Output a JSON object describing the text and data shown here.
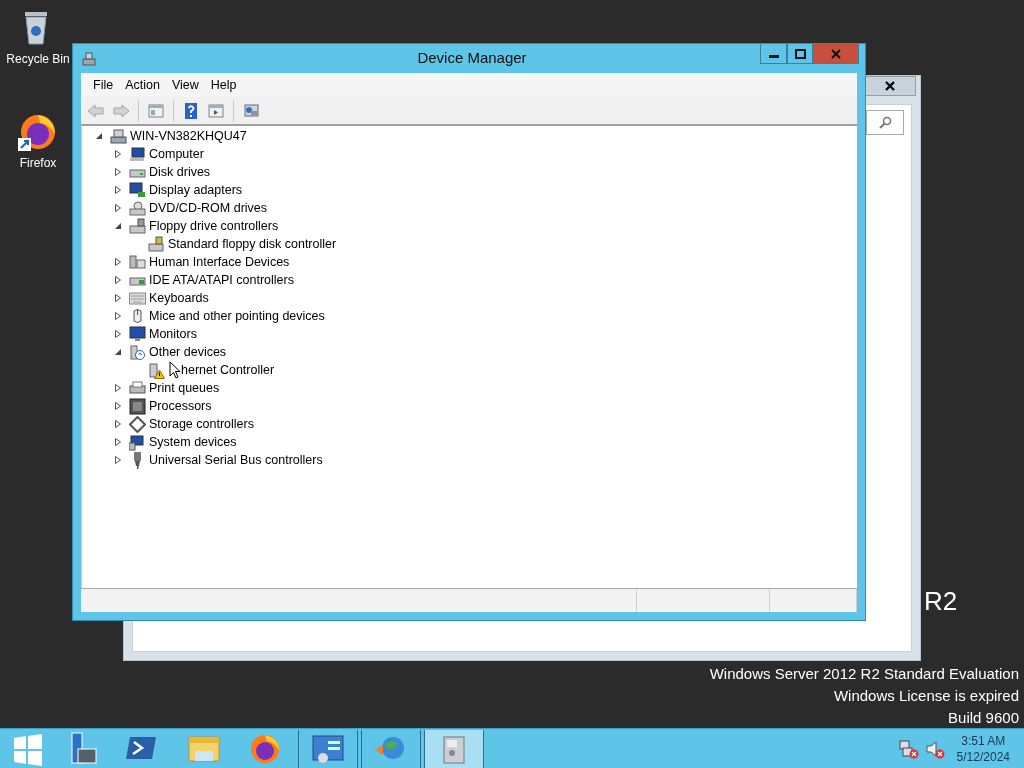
{
  "desktop_icons": [
    {
      "label": "Recycle Bin"
    },
    {
      "label": "Firefox"
    }
  ],
  "desktop_text": {
    "edition": "R2",
    "lines": [
      "Windows Server 2012 R2 Standard Evaluation",
      "Windows License is expired",
      "Build 9600"
    ]
  },
  "window": {
    "title": "Device Manager",
    "menu": [
      "File",
      "Action",
      "View",
      "Help"
    ],
    "toolbar": [
      {
        "disabled": true
      },
      {
        "disabled": true
      },
      {
        "disabled": false
      },
      {
        "disabled": false
      },
      {
        "disabled": false
      },
      {
        "disabled": false
      }
    ],
    "tree": {
      "label": "WIN-VN382KHQU47",
      "expanded": true,
      "children": [
        {
          "label": "Computer",
          "expanded": false
        },
        {
          "label": "Disk drives",
          "expanded": false
        },
        {
          "label": "Display adapters",
          "expanded": false
        },
        {
          "label": "DVD/CD-ROM drives",
          "expanded": false
        },
        {
          "label": "Floppy drive controllers",
          "expanded": true,
          "children": [
            {
              "label": "Standard floppy disk controller",
              "warning": false
            }
          ]
        },
        {
          "label": "Human Interface Devices",
          "expanded": false
        },
        {
          "label": "IDE ATA/ATAPI controllers",
          "expanded": false
        },
        {
          "label": "Keyboards",
          "expanded": false
        },
        {
          "label": "Mice and other pointing devices",
          "expanded": false
        },
        {
          "label": "Monitors",
          "expanded": false
        },
        {
          "label": "Other devices",
          "expanded": true,
          "children": [
            {
              "label": "hernet Controller",
              "warning": true
            }
          ]
        },
        {
          "label": "Print queues",
          "expanded": false
        },
        {
          "label": "Processors",
          "expanded": false
        },
        {
          "label": "Storage controllers",
          "expanded": false
        },
        {
          "label": "System devices",
          "expanded": false
        },
        {
          "label": "Universal Serial Bus controllers",
          "expanded": false
        }
      ]
    }
  },
  "taskbar": {
    "items": [
      {
        "selected": false
      },
      {
        "selected": false
      },
      {
        "selected": false
      },
      {
        "selected": false
      },
      {
        "selected": false
      },
      {
        "selected": false
      },
      {
        "selected": false
      },
      {
        "selected": true
      }
    ],
    "clock": {
      "time": "3:51 AM",
      "date": "5/12/2024"
    }
  }
}
